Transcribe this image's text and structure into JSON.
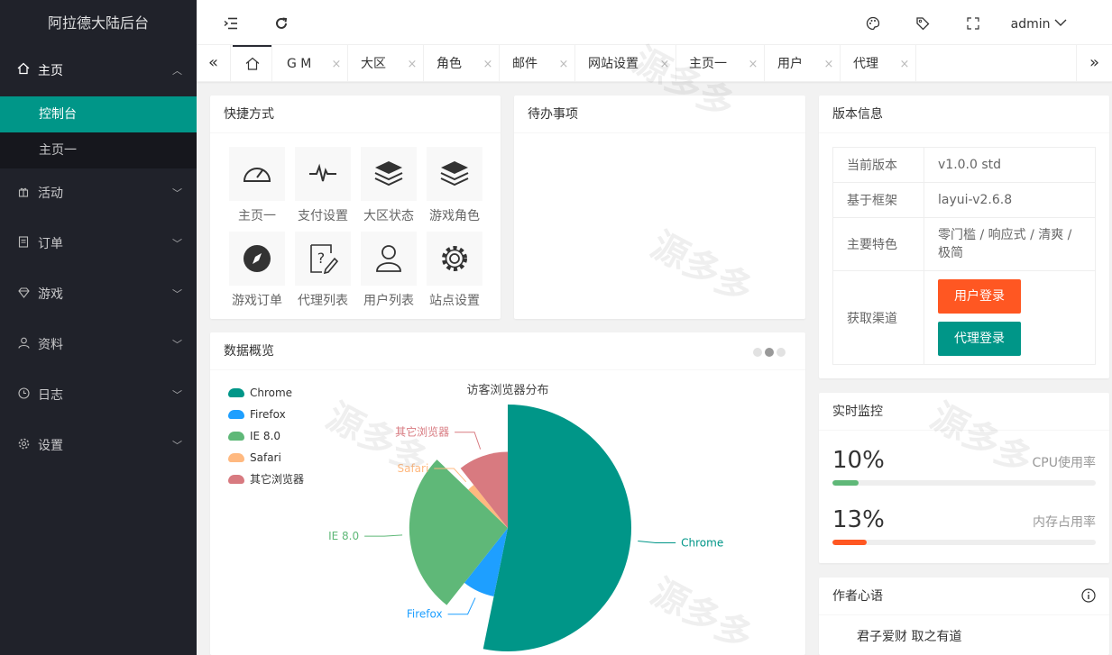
{
  "app": {
    "title": "阿拉德大陆后台"
  },
  "sidebar": {
    "items": [
      {
        "label": "主页",
        "icon": "home-icon",
        "open": true,
        "children": [
          {
            "label": "控制台",
            "active": true
          },
          {
            "label": "主页一",
            "active": false
          }
        ]
      },
      {
        "label": "活动",
        "icon": "gift-icon"
      },
      {
        "label": "订单",
        "icon": "order-icon"
      },
      {
        "label": "游戏",
        "icon": "diamond-icon"
      },
      {
        "label": "资料",
        "icon": "user-icon"
      },
      {
        "label": "日志",
        "icon": "clock-icon"
      },
      {
        "label": "设置",
        "icon": "gear-icon"
      }
    ]
  },
  "header": {
    "user": "admin"
  },
  "tabs": {
    "items": [
      {
        "label": "G M"
      },
      {
        "label": "大区"
      },
      {
        "label": "角色"
      },
      {
        "label": "邮件"
      },
      {
        "label": "网站设置"
      },
      {
        "label": "主页一"
      },
      {
        "label": "用户"
      },
      {
        "label": "代理"
      }
    ],
    "close_glyph": "×"
  },
  "shortcuts": {
    "title": "快捷方式",
    "items": [
      {
        "label": "主页一",
        "icon": "dashboard-icon"
      },
      {
        "label": "支付设置",
        "icon": "pulse-icon"
      },
      {
        "label": "大区状态",
        "icon": "layers-icon"
      },
      {
        "label": "游戏角色",
        "icon": "layers-icon"
      },
      {
        "label": "游戏订单",
        "icon": "compass-icon"
      },
      {
        "label": "代理列表",
        "icon": "help-edit-icon"
      },
      {
        "label": "用户列表",
        "icon": "user-icon"
      },
      {
        "label": "站点设置",
        "icon": "gear-icon"
      }
    ]
  },
  "todo": {
    "title": "待办事项"
  },
  "version": {
    "title": "版本信息",
    "rows": [
      {
        "key": "当前版本",
        "value": "v1.0.0 std"
      },
      {
        "key": "基于框架",
        "value": "layui-v2.6.8"
      },
      {
        "key": "主要特色",
        "value": "零门槛 / 响应式 / 清爽 / 极简"
      },
      {
        "key": "获取渠道",
        "value": ""
      }
    ],
    "buttons": [
      {
        "label": "用户登录",
        "color": "#ff5722"
      },
      {
        "label": "代理登录",
        "color": "#009688"
      }
    ]
  },
  "monitor": {
    "title": "实时监控",
    "items": [
      {
        "pct": "10%",
        "label": "CPU使用率",
        "value": 0.1,
        "color": "#5fb878"
      },
      {
        "pct": "13%",
        "label": "内存占用率",
        "value": 0.13,
        "color": "#ff5722"
      }
    ]
  },
  "author": {
    "title": "作者心语",
    "quote": "君子爱财 取之有道"
  },
  "overview": {
    "title": "数据概览"
  },
  "chart_data": {
    "type": "pie",
    "title": "访客浏览器分布",
    "categories": [
      "Chrome",
      "Firefox",
      "IE 8.0",
      "Safari",
      "其它浏览器"
    ],
    "values": [
      50,
      7,
      25,
      2,
      10
    ],
    "colors": [
      "#009688",
      "#1e9fff",
      "#5fb878",
      "#ffb980",
      "#d87a80"
    ],
    "legend": "top-left"
  },
  "watermark": "源多多"
}
